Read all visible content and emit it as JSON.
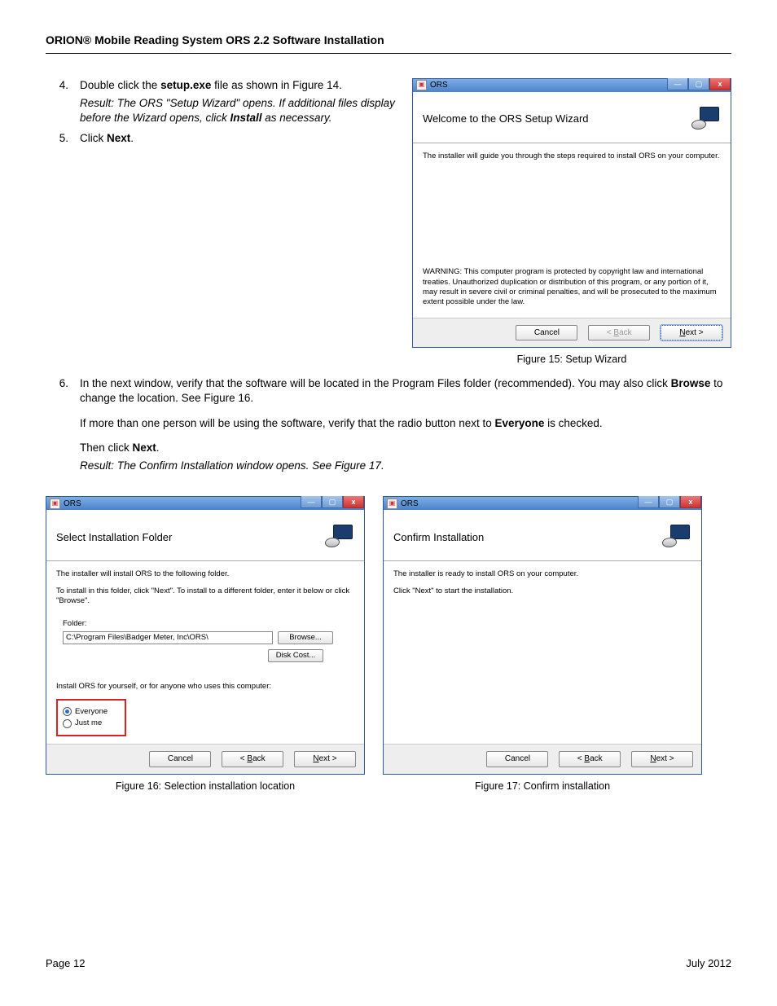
{
  "header": "ORION® Mobile Reading System ORS 2.2 Software Installation",
  "steps": {
    "s4": {
      "num": "4.",
      "text_a": "Double click the ",
      "text_b": "setup.exe",
      "text_c": " file as shown in Figure 14.",
      "result_a": "Result: The ORS \"Setup Wizard\" opens. If additional files display before the Wizard opens, click ",
      "result_b": "Install",
      "result_c": " as necessary."
    },
    "s5": {
      "num": "5.",
      "text_a": "Click ",
      "text_b": "Next",
      "text_c": "."
    },
    "s6": {
      "num": "6.",
      "line1_a": "In the next window, verify that the software will be located in the Program Files folder (recommended). You may also click ",
      "line1_b": "Browse",
      "line1_c": " to change the location. See Figure 16.",
      "line2_a": "If more than one person will be using the software, verify that the radio button next to ",
      "line2_b": "Everyone",
      "line2_c": " is checked.",
      "line3_a": "Then click ",
      "line3_b": "Next",
      "line3_c": ".",
      "result": "Result: The Confirm Installation window opens. See Figure 17."
    }
  },
  "fig15": {
    "window_title": "ORS",
    "banner": "Welcome to the ORS Setup Wizard",
    "body1": "The installer will guide you through the steps required to install ORS on your computer.",
    "warning": "WARNING: This computer program is protected by copyright law and international treaties. Unauthorized duplication or distribution of this program, or any portion of it, may result in severe civil or criminal penalties, and will be prosecuted to the maximum extent possible under the law.",
    "btn_cancel": "Cancel",
    "btn_back": "< Back",
    "btn_next": "Next >",
    "caption": "Figure 15:  Setup Wizard"
  },
  "fig16": {
    "window_title": "ORS",
    "banner": "Select Installation Folder",
    "body1": "The installer will install ORS to the following folder.",
    "body2": "To install in this folder, click \"Next\". To install to a different folder, enter it below or click \"Browse\".",
    "folder_label": "Folder:",
    "folder_value": "C:\\Program Files\\Badger Meter, Inc\\ORS\\",
    "browse": "Browse...",
    "diskcost": "Disk Cost...",
    "scope": "Install ORS for yourself, or for anyone who uses this computer:",
    "radio_everyone": "Everyone",
    "radio_justme": "Just me",
    "btn_cancel": "Cancel",
    "btn_back": "< Back",
    "btn_next": "Next >",
    "caption": "Figure 16:  Selection installation location"
  },
  "fig17": {
    "window_title": "ORS",
    "banner": "Confirm Installation",
    "body1": "The installer is ready to install ORS on your computer.",
    "body2": "Click \"Next\" to start the installation.",
    "btn_cancel": "Cancel",
    "btn_back": "< Back",
    "btn_next": "Next >",
    "caption": "Figure 17:  Confirm installation"
  },
  "footer": {
    "left": "Page 12",
    "right": "July 2012"
  }
}
